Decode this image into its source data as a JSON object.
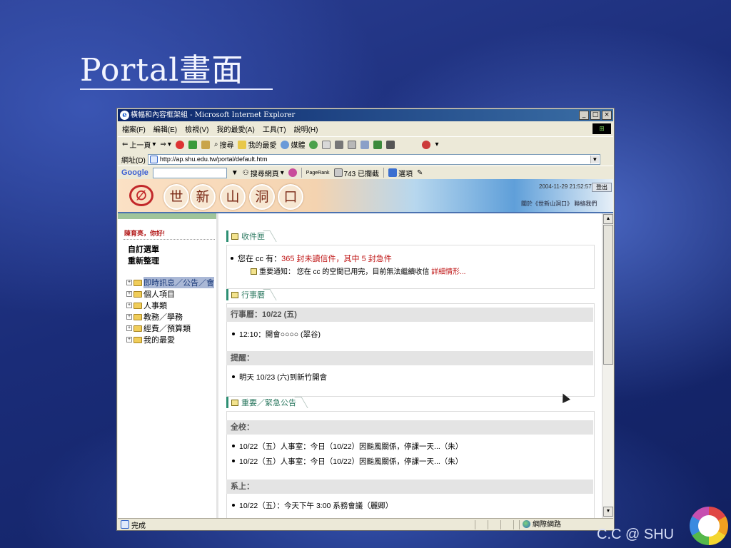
{
  "slide": {
    "title": "Portal畫面",
    "footer": "C.C @ SHU"
  },
  "window": {
    "title": "橫幅和內容框架組 - Microsoft Internet Explorer",
    "controls": [
      "_",
      "□",
      "×"
    ]
  },
  "menu": [
    "檔案(F)",
    "編輯(E)",
    "檢視(V)",
    "我的最愛(A)",
    "工具(T)",
    "說明(H)"
  ],
  "toolbar": {
    "back": "上一頁",
    "search": "搜尋",
    "favorites": "我的最愛",
    "media": "媒體"
  },
  "address": {
    "label": "網址(D)",
    "url": "http://ap.shu.edu.tw/portal/default.htm"
  },
  "google_bar": {
    "logo": "Google",
    "search_web": "搜尋網頁",
    "pagerank": "PageRank",
    "blocked": "743 已攔截",
    "options": "選項"
  },
  "banner": {
    "chars": [
      "世",
      "新",
      "山",
      "洞",
      "口"
    ],
    "timestamp": "2004-11-29 21:52:57",
    "logout": "登出",
    "about": "關於《世新山洞口》",
    "contact": "聯絡我們"
  },
  "sidebar": {
    "greeting": "陳育亮，你好!",
    "links": [
      "自訂選單",
      "重新整理"
    ],
    "tree": [
      "即時訊息／公告／會",
      "個人項目",
      "人事類",
      "教務／學務",
      "經費／預算類",
      "我的最愛"
    ]
  },
  "inbox": {
    "title": "收件匣",
    "line_prefix": "您在 cc 有：",
    "line_highlight": "365 封未讀信件，其中 5 封急件",
    "notice_prefix": "重要通知：  您在 cc 的空間已用完，目前無法繼續收信 ",
    "notice_link": "詳細情形..."
  },
  "calendar": {
    "title": "行事曆",
    "header": "行事曆：10/22 (五)",
    "item": "12:10：開會○○○○ (翠谷)",
    "reminder_label": "提醒：",
    "reminder_item": "明天 10/23 (六)到新竹開會"
  },
  "announcements": {
    "title": "重要／緊急公告",
    "school_label": "全校：",
    "items": [
      "10/22（五）人事室：今日（10/22）因颱風關係，停課一天...（朱）",
      "10/22（五）人事室：今日（10/22）因颱風關係，停課一天...（朱）"
    ],
    "dept_label": "系上：",
    "dept_item": "10/22（五）：今天下午 3:00 系務會議（麗卿）"
  },
  "status": {
    "text": "完成",
    "zone": "網際網路"
  }
}
